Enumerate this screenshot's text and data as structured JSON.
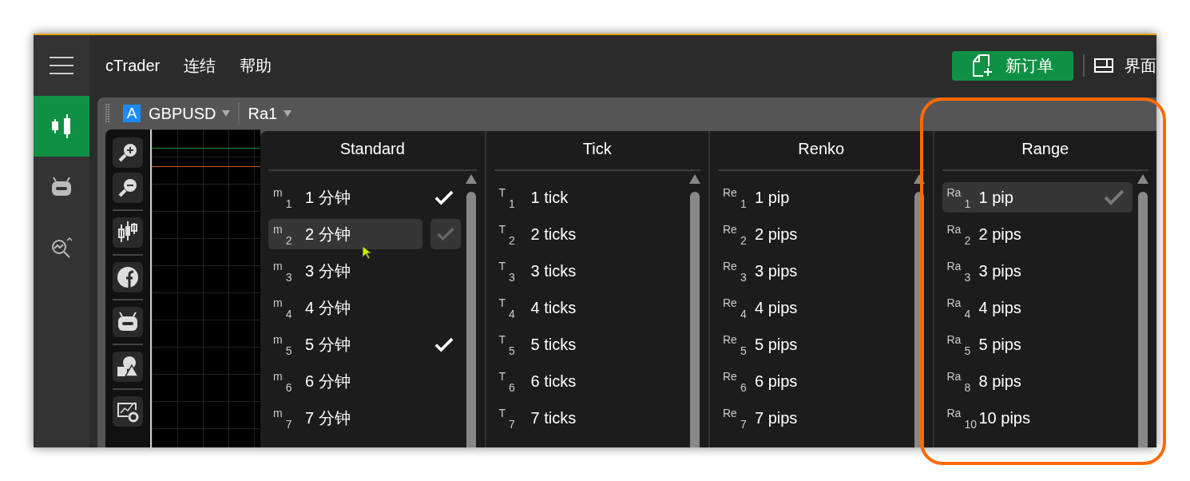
{
  "top_menu": [
    "cTrader",
    "连结",
    "帮助"
  ],
  "new_order_button": "新订单",
  "layout_button": "界面",
  "nav": [
    {
      "kind": "chart",
      "selected": true
    },
    {
      "kind": "robot",
      "selected": false
    },
    {
      "kind": "analysis",
      "selected": false
    }
  ],
  "chart_toolbar": {
    "badge": "A",
    "symbol": "GBPUSD",
    "timeframe": "Ra1"
  },
  "timeframe_columns": [
    {
      "title": "Standard",
      "items": [
        {
          "code": "m$_{1}$",
          "label": "1 分钟",
          "selected": false,
          "hovered": false,
          "checked": true
        },
        {
          "code": "m$_{2}$",
          "label": "2 分钟",
          "selected": false,
          "hovered": true,
          "checked": false
        },
        {
          "code": "m$_{3}$",
          "label": "3 分钟",
          "selected": false,
          "hovered": false,
          "checked": false
        },
        {
          "code": "m$_{4}$",
          "label": "4 分钟",
          "selected": false,
          "hovered": false,
          "checked": false
        },
        {
          "code": "m$_{5}$",
          "label": "5 分钟",
          "selected": false,
          "hovered": false,
          "checked": true
        },
        {
          "code": "m$_{6}$",
          "label": "6 分钟",
          "selected": false,
          "hovered": false,
          "checked": false
        },
        {
          "code": "m$_{7}$",
          "label": "7 分钟",
          "selected": false,
          "hovered": false,
          "checked": false
        }
      ]
    },
    {
      "title": "Tick",
      "items": [
        {
          "code": "T$_{1}$",
          "label": "1 tick",
          "selected": false,
          "hovered": false,
          "checked": false
        },
        {
          "code": "T$_{2}$",
          "label": "2 ticks",
          "selected": false,
          "hovered": false,
          "checked": false
        },
        {
          "code": "T$_{3}$",
          "label": "3 ticks",
          "selected": false,
          "hovered": false,
          "checked": false
        },
        {
          "code": "T$_{4}$",
          "label": "4 ticks",
          "selected": false,
          "hovered": false,
          "checked": false
        },
        {
          "code": "T$_{5}$",
          "label": "5 ticks",
          "selected": false,
          "hovered": false,
          "checked": false
        },
        {
          "code": "T$_{6}$",
          "label": "6 ticks",
          "selected": false,
          "hovered": false,
          "checked": false
        },
        {
          "code": "T$_{7}$",
          "label": "7 ticks",
          "selected": false,
          "hovered": false,
          "checked": false
        }
      ]
    },
    {
      "title": "Renko",
      "items": [
        {
          "code": "Re$_{1}$",
          "label": "1 pip",
          "selected": false,
          "hovered": false,
          "checked": false
        },
        {
          "code": "Re$_{2}$",
          "label": "2 pips",
          "selected": false,
          "hovered": false,
          "checked": false
        },
        {
          "code": "Re$_{3}$",
          "label": "3 pips",
          "selected": false,
          "hovered": false,
          "checked": false
        },
        {
          "code": "Re$_{4}$",
          "label": "4 pips",
          "selected": false,
          "hovered": false,
          "checked": false
        },
        {
          "code": "Re$_{5}$",
          "label": "5 pips",
          "selected": false,
          "hovered": false,
          "checked": false
        },
        {
          "code": "Re$_{6}$",
          "label": "6 pips",
          "selected": false,
          "hovered": false,
          "checked": false
        },
        {
          "code": "Re$_{7}$",
          "label": "7 pips",
          "selected": false,
          "hovered": false,
          "checked": false
        }
      ]
    },
    {
      "title": "Range",
      "items": [
        {
          "code": "Ra$_{1}$",
          "label": "1 pip",
          "selected": true,
          "hovered": false,
          "checked": false
        },
        {
          "code": "Ra$_{2}$",
          "label": "2 pips",
          "selected": false,
          "hovered": false,
          "checked": false
        },
        {
          "code": "Ra$_{3}$",
          "label": "3 pips",
          "selected": false,
          "hovered": false,
          "checked": false
        },
        {
          "code": "Ra$_{4}$",
          "label": "4 pips",
          "selected": false,
          "hovered": false,
          "checked": false
        },
        {
          "code": "Ra$_{5}$",
          "label": "5 pips",
          "selected": false,
          "hovered": false,
          "checked": false
        },
        {
          "code": "Ra$_{8}$",
          "label": "8 pips",
          "selected": false,
          "hovered": false,
          "checked": false
        },
        {
          "code": "Ra$_{10}$",
          "label": "10 pips",
          "selected": false,
          "hovered": false,
          "checked": false
        }
      ]
    }
  ]
}
